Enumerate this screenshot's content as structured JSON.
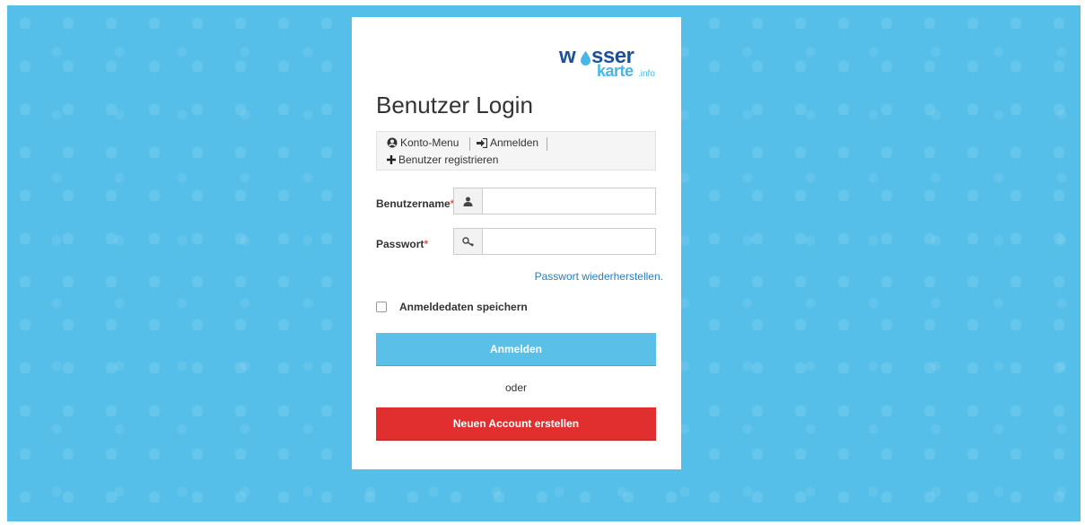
{
  "logo": {
    "part1": "w",
    "part2": "sser",
    "part3": "karte",
    "part4": ".info"
  },
  "page_title": "Benutzer Login",
  "menu": {
    "konto": {
      "label": "Konto-Menu",
      "icon": "user-circle-icon"
    },
    "anmelden": {
      "label": "Anmelden",
      "icon": "sign-in-icon"
    },
    "register": {
      "label": "Benutzer registrieren",
      "icon": "plus-icon"
    }
  },
  "form": {
    "username": {
      "label": "Benutzername",
      "required_mark": "*",
      "value": "",
      "placeholder": "",
      "icon": "user-icon"
    },
    "password": {
      "label": "Passwort",
      "required_mark": "*",
      "value": "",
      "placeholder": "",
      "icon": "key-icon"
    },
    "forgot_link": "Passwort wiederherstellen.",
    "remember": {
      "label": "Anmeldedaten speichern",
      "checked": false
    },
    "login_button": "Anmelden",
    "or_text": "oder",
    "create_button": "Neuen Account erstellen"
  },
  "colors": {
    "background": "#55bfe9",
    "login_button": "#5bc0e8",
    "create_button": "#e12f2f",
    "link": "#2a7db8",
    "required": "#d9534f"
  }
}
